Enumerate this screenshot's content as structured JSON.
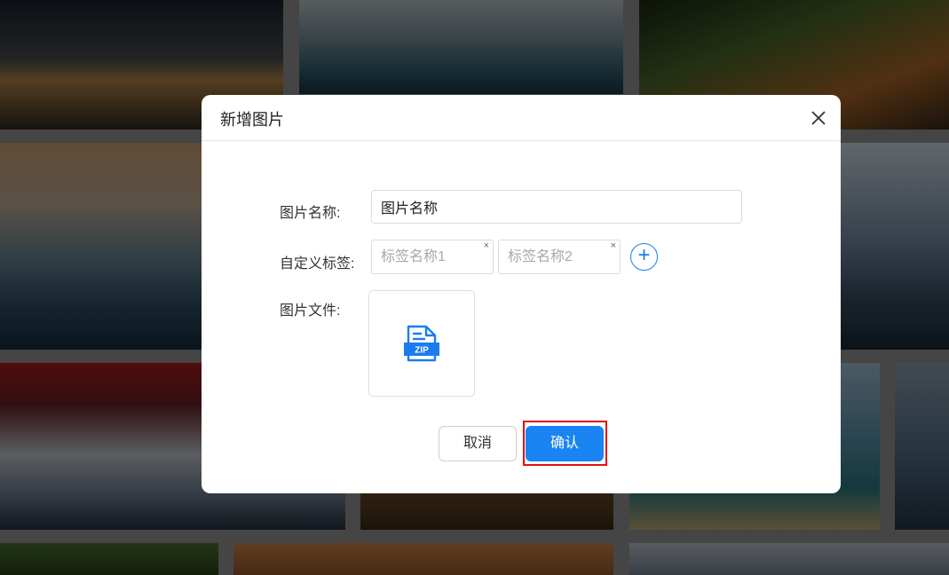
{
  "dialog": {
    "title": "新增图片",
    "close_icon": "close-icon"
  },
  "form": {
    "name_label": "图片名称:",
    "name_value": "图片名称",
    "tags_label": "自定义标签:",
    "tags": [
      {
        "placeholder": "标签名称1",
        "clear": "×"
      },
      {
        "placeholder": "标签名称2",
        "clear": "×"
      }
    ],
    "add_tag_symbol": "+",
    "file_label": "图片文件:",
    "file_icon": "zip-file-icon",
    "file_icon_text": "ZIP"
  },
  "buttons": {
    "cancel": "取消",
    "confirm": "确认"
  },
  "colors": {
    "primary": "#1a84f2",
    "highlight": "#e01010"
  }
}
